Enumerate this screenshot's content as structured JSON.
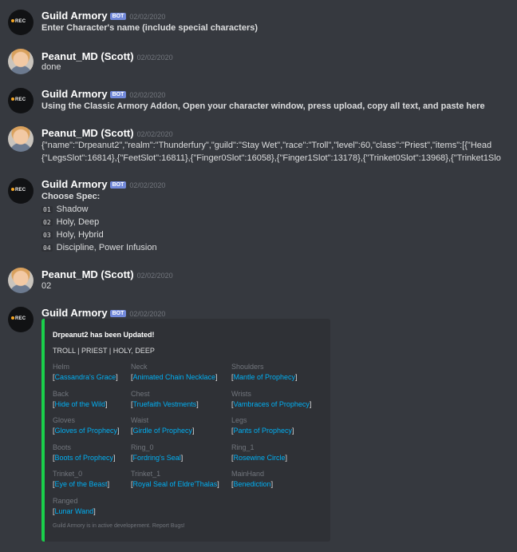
{
  "messages": [
    {
      "type": "bot",
      "username": "Guild Armory",
      "badge": "BOT",
      "time": "02/02/2020",
      "avatar_text": "REC",
      "lines": [
        "Enter Character's name (include special characters)"
      ]
    },
    {
      "type": "human",
      "username": "Peanut_MD (Scott)",
      "time": "02/02/2020",
      "lines": [
        "done"
      ]
    },
    {
      "type": "bot",
      "username": "Guild Armory",
      "badge": "BOT",
      "time": "02/02/2020",
      "avatar_text": "REC",
      "lines": [
        "Using the Classic Armory Addon, Open your character window, press upload, copy all text, and paste here"
      ]
    },
    {
      "type": "human",
      "username": "Peanut_MD (Scott)",
      "time": "02/02/2020",
      "lines": [
        "{\"name\":\"Drpeanut2\",\"realm\":\"Thunderfury\",\"guild\":\"Stay Wet\",\"race\":\"Troll\",\"level\":60,\"class\":\"Priest\",\"items\":[{\"Head",
        "{\"LegsSlot\":16814},{\"FeetSlot\":16811},{\"Finger0Slot\":16058},{\"Finger1Slot\":13178},{\"Trinket0Slot\":13968},{\"Trinket1Slo"
      ]
    },
    {
      "type": "bot",
      "username": "Guild Armory",
      "badge": "BOT",
      "time": "02/02/2020",
      "avatar_text": "REC",
      "heading": "Choose Spec:",
      "options": [
        {
          "num": "01",
          "label": "Shadow"
        },
        {
          "num": "02",
          "label": "Holy, Deep"
        },
        {
          "num": "03",
          "label": "Holy, Hybrid"
        },
        {
          "num": "04",
          "label": "Discipline, Power Infusion"
        }
      ]
    },
    {
      "type": "human",
      "username": "Peanut_MD (Scott)",
      "time": "02/02/2020",
      "lines": [
        "02"
      ]
    },
    {
      "type": "bot",
      "username": "Guild Armory",
      "badge": "BOT",
      "time": "02/02/2020",
      "avatar_text": "REC"
    }
  ],
  "embed": {
    "accent_color": "#1ad04a",
    "title": "Drpeanut2 has been Updated!",
    "description": "TROLL | PRIEST | HOLY, DEEP",
    "fields": [
      {
        "name": "Helm",
        "value": "Cassandra's Grace"
      },
      {
        "name": "Neck",
        "value": "Animated Chain Necklace"
      },
      {
        "name": "Shoulders",
        "value": "Mantle of Prophecy"
      },
      {
        "name": "Back",
        "value": "Hide of the Wild"
      },
      {
        "name": "Chest",
        "value": "Truefaith Vestments"
      },
      {
        "name": "Wrists",
        "value": "Vambraces of Prophecy"
      },
      {
        "name": "Gloves",
        "value": "Gloves of Prophecy"
      },
      {
        "name": "Waist",
        "value": "Girdle of Prophecy"
      },
      {
        "name": "Legs",
        "value": "Pants of Prophecy"
      },
      {
        "name": "Boots",
        "value": "Boots of Prophecy"
      },
      {
        "name": "Ring_0",
        "value": "Fordring's Seal"
      },
      {
        "name": "Ring_1",
        "value": "Rosewine Circle"
      },
      {
        "name": "Trinket_0",
        "value": "Eye of the Beast"
      },
      {
        "name": "Trinket_1",
        "value": "Royal Seal of Eldre'Thalas"
      },
      {
        "name": "MainHand",
        "value": "Benediction"
      },
      {
        "name": "Ranged",
        "value": "Lunar Wand"
      }
    ],
    "footer": "Guild Armory is in active developement. Report Bugs!"
  },
  "colors": {
    "background": "#36393f",
    "embed_background": "#2f3136",
    "link": "#00b0f4",
    "bot_badge": "#7289da"
  }
}
